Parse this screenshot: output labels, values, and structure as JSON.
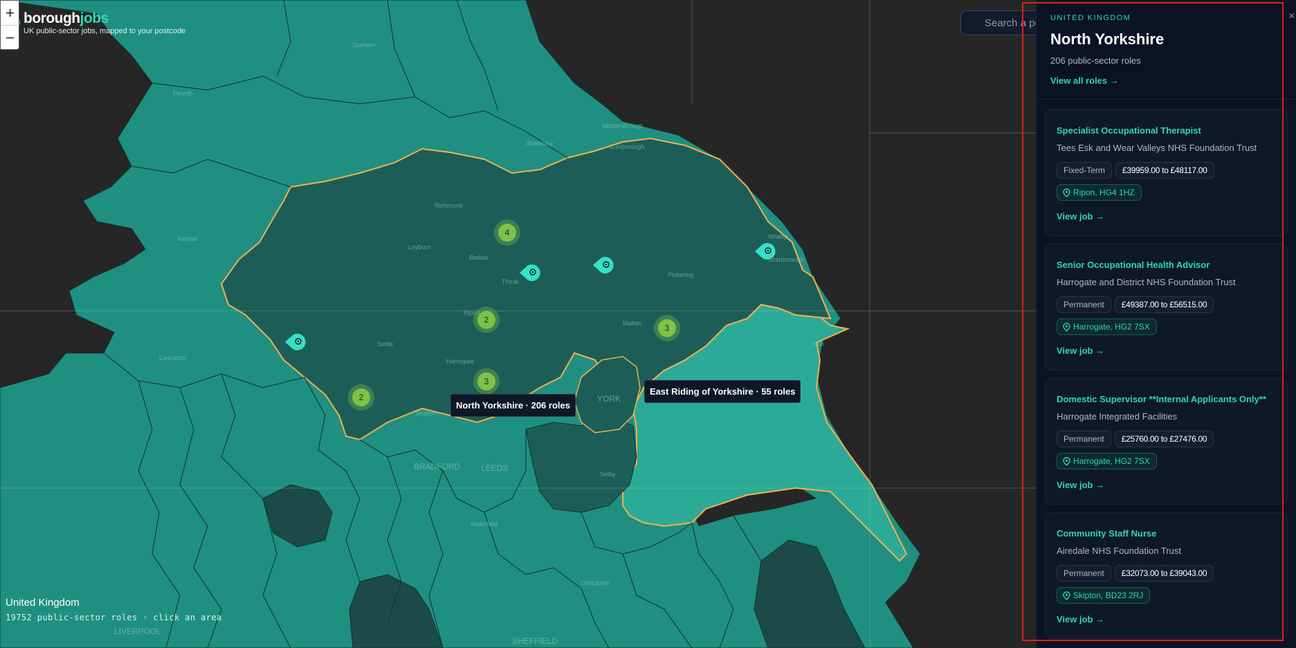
{
  "app": {
    "brand_prefix": "borough",
    "brand_suffix": "jobs",
    "tagline": "UK public-sector jobs, mapped to your postcode",
    "zoom_in": "+",
    "zoom_out": "−",
    "search_placeholder": "Search a po"
  },
  "status": {
    "title": "United Kingdom",
    "subtitle": "19752 public-sector roles · click an area"
  },
  "panel": {
    "country": "UNITED KINGDOM",
    "region": "North Yorkshire",
    "count": "206 public-sector roles",
    "view_all": "View all roles →",
    "close": "×",
    "jobs": [
      {
        "title": "Specialist Occupational Therapist",
        "org": "Tees Esk and Wear Valleys NHS Foundation Trust",
        "type": "Fixed-Term",
        "salary": "£39959.00 to £48117.00",
        "location": "Ripon, HG4 1HZ",
        "link": "View job →"
      },
      {
        "title": "Senior Occupational Health Advisor",
        "org": "Harrogate and District NHS Foundation Trust",
        "type": "Permanent",
        "salary": "£49387.00 to £56515.00",
        "location": "Harrogate, HG2 7SX",
        "link": "View job →"
      },
      {
        "title": "Domestic Supervisor **Internal Applicants Only**",
        "org": "Harrogate Integrated Facilities",
        "type": "Permanent",
        "salary": "£25760.00 to £27476.00",
        "location": "Harrogate, HG2 7SX",
        "link": "View job →"
      },
      {
        "title": "Community Staff Nurse",
        "org": "Airedale NHS Foundation Trust",
        "type": "Permanent",
        "salary": "£32073.00 to £39043.00",
        "location": "Skipton, BD23 2RJ",
        "link": "View job →"
      }
    ]
  },
  "map": {
    "tooltips": [
      {
        "text": "North Yorkshire · 206 roles"
      },
      {
        "text": "East Riding of Yorkshire · 55 roles"
      }
    ],
    "clusters": [
      "4",
      "2",
      "3",
      "3",
      "2"
    ],
    "labels": [
      "Durham",
      "Richmond",
      "Thirsk",
      "Pickering",
      "Scarborough",
      "Ripon",
      "Harrogate",
      "Skipton",
      "YORK",
      "LEEDS",
      "BRADFORD",
      "Selby",
      "Kendal",
      "Lancaster",
      "Middlesbrough",
      "Hull",
      "Wakefield",
      "Doncaster",
      "Malton",
      "Bedale",
      "Leyburn",
      "Guisborough",
      "Stokesley",
      "Settle",
      "Whitby",
      "Penrith",
      "LIVERPOOL",
      "SHEFFIELD"
    ],
    "colors": {
      "land": "#1f8f82",
      "north_yorkshire": "#1c5e57",
      "east_riding": "#2bab97",
      "dark_area": "#1c4a48",
      "water": "#262626",
      "highlight_border": "#f5b04a",
      "cluster": "#7ec14a",
      "pin": "#35e0c6"
    }
  }
}
